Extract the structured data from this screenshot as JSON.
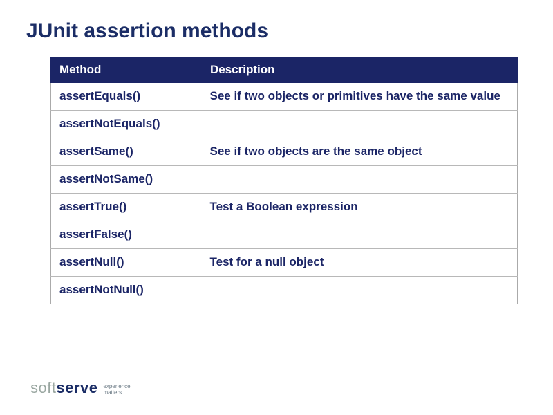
{
  "title": "JUnit assertion methods",
  "table": {
    "headers": {
      "method": "Method",
      "description": "Description"
    },
    "rows": [
      {
        "method": "assertEquals()",
        "description": "See if two objects or primitives have the same value"
      },
      {
        "method": "assertNotEquals()",
        "description": ""
      },
      {
        "method": "assertSame()",
        "description": "See if two objects are the same object"
      },
      {
        "method": "assertNotSame()",
        "description": ""
      },
      {
        "method": "assertTrue()",
        "description": "Test a Boolean expression"
      },
      {
        "method": "assertFalse()",
        "description": ""
      },
      {
        "method": "assertNull()",
        "description": "Test for a null object"
      },
      {
        "method": "assertNotNull()",
        "description": ""
      }
    ]
  },
  "footer": {
    "logo_soft": "soft",
    "logo_serve": "serve",
    "tagline_line1": "experience",
    "tagline_line2": "matters"
  }
}
